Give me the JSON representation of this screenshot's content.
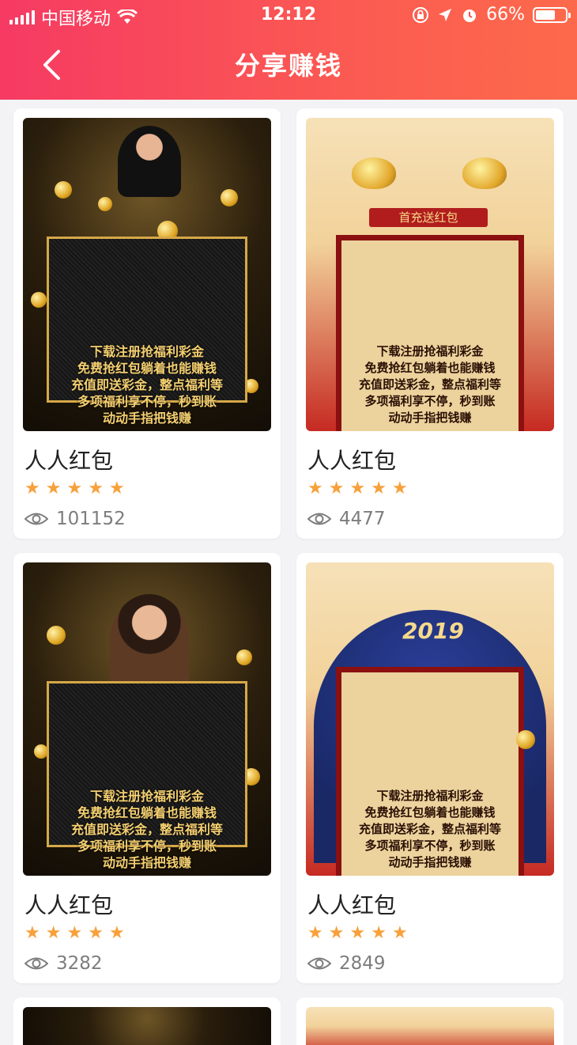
{
  "status": {
    "carrier": "中国移动",
    "time": "12:12",
    "battery": "66%",
    "battery_level": 0.66
  },
  "nav": {
    "title": "分享赚钱",
    "back_icon": "chevron-left-icon"
  },
  "colors": {
    "header_start": "#f63a63",
    "header_end": "#fd6a4b",
    "star": "#f8a03a",
    "muted": "#7d7d7d"
  },
  "cards": [
    {
      "name": "人人红包",
      "rating": 5,
      "views": "101152",
      "poster_lines": [
        "下载注册抢福利彩金",
        "免费抢红包躺着也能赚钱",
        "充值即送彩金，整点福利等",
        "多项福利享不停，秒到账",
        "动动手指把钱赚"
      ]
    },
    {
      "name": "人人红包",
      "rating": 5,
      "views": "4477",
      "poster_banner": "首充送红包",
      "poster_lines": [
        "下载注册抢福利彩金",
        "免费抢红包躺着也能赚钱",
        "充值即送彩金，整点福利等",
        "多项福利享不停，秒到账",
        "动动手指把钱赚"
      ]
    },
    {
      "name": "人人红包",
      "rating": 5,
      "views": "3282",
      "poster_lines": [
        "下载注册抢福利彩金",
        "免费抢红包躺着也能赚钱",
        "充值即送彩金，整点福利等",
        "多项福利享不停，秒到账",
        "动动手指把钱赚"
      ]
    },
    {
      "name": "人人红包",
      "rating": 5,
      "views": "2849",
      "poster_year": "2019",
      "poster_lines": [
        "下载注册抢福利彩金",
        "免费抢红包躺着也能赚钱",
        "充值即送彩金，整点福利等",
        "多项福利享不停，秒到账",
        "动动手指把钱赚"
      ]
    }
  ]
}
